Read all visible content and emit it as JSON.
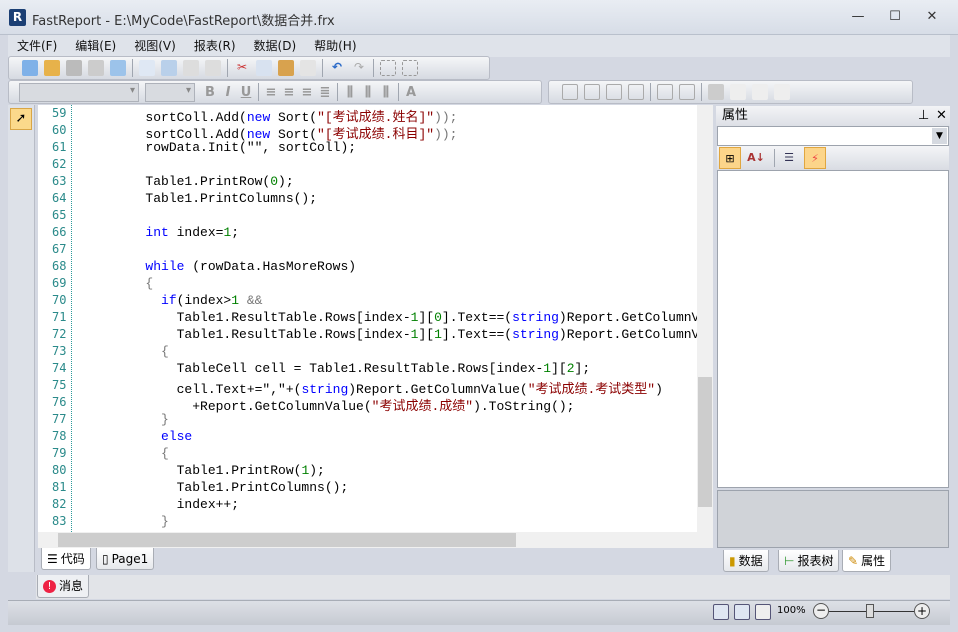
{
  "window": {
    "title": "FastReport - E:\\MyCode\\FastReport\\数据合并.frx",
    "minimize": "—",
    "maximize": "☐",
    "close": "✕"
  },
  "menu": [
    "文件(F)",
    "编辑(E)",
    "视图(V)",
    "报表(R)",
    "数据(D)",
    "帮助(H)"
  ],
  "editor": {
    "line_numbers": [
      "59",
      "60",
      "61",
      "62",
      "63",
      "64",
      "65",
      "66",
      "67",
      "68",
      "69",
      "70",
      "71",
      "72",
      "73",
      "74",
      "75",
      "76",
      "77",
      "78",
      "79",
      "80",
      "81",
      "82",
      "83"
    ],
    "lines": [
      [
        [
          "        sortColl.Add",
          ""
        ],
        [
          "(",
          ""
        ],
        [
          "new",
          "kw"
        ],
        [
          " Sort(",
          ""
        ],
        [
          "\"[考试成绩.姓名]\"",
          "st"
        ],
        [
          "));",
          "pn"
        ]
      ],
      [
        [
          "        sortColl.Add(",
          ""
        ],
        [
          "new",
          "kw"
        ],
        [
          " Sort(",
          ""
        ],
        [
          "\"[考试成绩.科目]\"",
          "st"
        ],
        [
          "));",
          "pn"
        ]
      ],
      [
        [
          "        rowData.Init(\"\", sortColl);",
          ""
        ]
      ],
      [
        [
          "",
          ""
        ]
      ],
      [
        [
          "        Table1.PrintRow(",
          ""
        ],
        [
          "0",
          "nm"
        ],
        [
          ");",
          ""
        ]
      ],
      [
        [
          "        Table1.PrintColumns();",
          ""
        ]
      ],
      [
        [
          "",
          ""
        ]
      ],
      [
        [
          "        ",
          ""
        ],
        [
          "int",
          "kw"
        ],
        [
          " index=",
          ""
        ],
        [
          "1",
          "nm"
        ],
        [
          ";",
          ""
        ]
      ],
      [
        [
          "",
          ""
        ]
      ],
      [
        [
          "        ",
          ""
        ],
        [
          "while",
          "kw"
        ],
        [
          " (rowData.HasMoreRows)",
          ""
        ]
      ],
      [
        [
          "        {",
          "pn"
        ]
      ],
      [
        [
          "          ",
          ""
        ],
        [
          "if",
          "kw"
        ],
        [
          "(index>",
          ""
        ],
        [
          "1",
          "nm"
        ],
        [
          " &&",
          "pn"
        ]
      ],
      [
        [
          "            Table1.ResultTable.Rows[index-",
          ""
        ],
        [
          "1",
          "nm"
        ],
        [
          "][",
          ""
        ],
        [
          "0",
          "nm"
        ],
        [
          "].Text==(",
          ""
        ],
        [
          "string",
          "kw"
        ],
        [
          ")Report.GetColumnValue(",
          ""
        ]
      ],
      [
        [
          "            Table1.ResultTable.Rows[index-",
          ""
        ],
        [
          "1",
          "nm"
        ],
        [
          "][",
          ""
        ],
        [
          "1",
          "nm"
        ],
        [
          "].Text==(",
          ""
        ],
        [
          "string",
          "kw"
        ],
        [
          ")Report.GetColumnValue(",
          ""
        ]
      ],
      [
        [
          "          {",
          "pn"
        ]
      ],
      [
        [
          "            TableCell cell = Table1.ResultTable.Rows[index-",
          ""
        ],
        [
          "1",
          "nm"
        ],
        [
          "][",
          ""
        ],
        [
          "2",
          "nm"
        ],
        [
          "];",
          ""
        ]
      ],
      [
        [
          "            cell.Text+=\",\"+(",
          ""
        ],
        [
          "string",
          "kw"
        ],
        [
          ")Report.GetColumnValue(",
          ""
        ],
        [
          "\"考试成绩.考试类型\"",
          "st"
        ],
        [
          ")",
          ""
        ]
      ],
      [
        [
          "              +Report.GetColumnValue(",
          ""
        ],
        [
          "\"考试成绩.成绩\"",
          "st"
        ],
        [
          ").ToString();",
          ""
        ]
      ],
      [
        [
          "          }",
          "pn"
        ]
      ],
      [
        [
          "          ",
          ""
        ],
        [
          "else",
          "kw"
        ]
      ],
      [
        [
          "          {",
          "pn"
        ]
      ],
      [
        [
          "            Table1.PrintRow(",
          ""
        ],
        [
          "1",
          "nm"
        ],
        [
          ");",
          ""
        ]
      ],
      [
        [
          "            Table1.PrintColumns();",
          ""
        ]
      ],
      [
        [
          "            index++;",
          ""
        ]
      ],
      [
        [
          "          }",
          "pn"
        ]
      ]
    ]
  },
  "editor_tabs": [
    {
      "label": "代码",
      "active": true
    },
    {
      "label": "Page1",
      "active": false
    }
  ],
  "properties_panel": {
    "title": "属性",
    "pin": "⊥",
    "close": "✕",
    "object_combo": "",
    "tabs": [
      "数据",
      "报表树",
      "属性"
    ]
  },
  "messages_tab": "消息",
  "status": {
    "zoom": "100%",
    "zoom_level": 1.0
  },
  "colors": {
    "keyword": "#0000ff",
    "string": "#8b0000",
    "number": "#008000",
    "line_number": "#2a8a8a"
  }
}
